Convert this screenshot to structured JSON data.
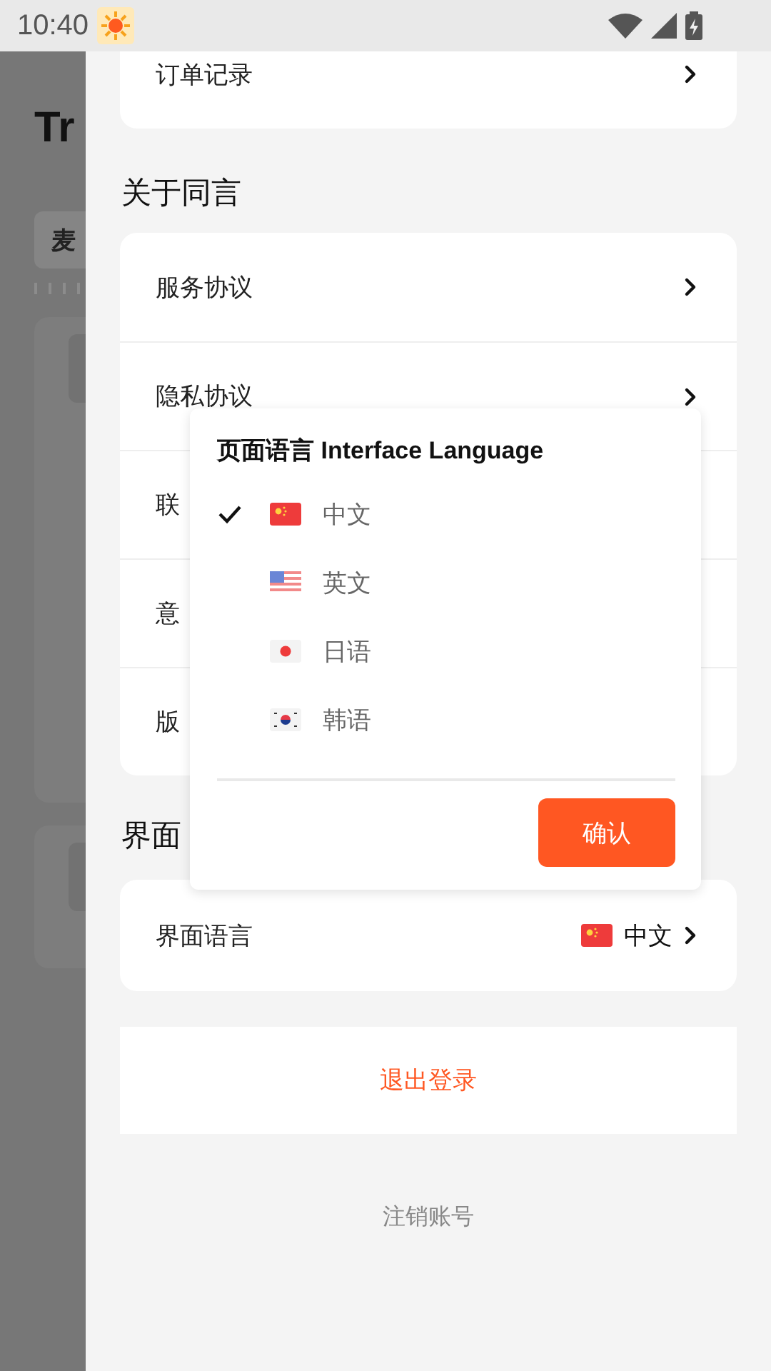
{
  "status_bar": {
    "time": "10:40"
  },
  "background_page": {
    "title": "Tr",
    "tab": "麦"
  },
  "order_row": {
    "label": "订单记录"
  },
  "about_section": {
    "heading": "关于同言",
    "rows": [
      {
        "label": "服务协议",
        "chevron": true
      },
      {
        "label": "隐私协议",
        "chevron": true
      },
      {
        "label": "联",
        "chevron": false
      },
      {
        "label": "意",
        "chevron": false
      },
      {
        "label": "版",
        "chevron": false
      }
    ]
  },
  "interface_section": {
    "heading": "界面",
    "row": {
      "label": "界面语言",
      "value": "中文",
      "kind": "cn"
    }
  },
  "logout_button": "退出登录",
  "delete_account_link": "注销账号",
  "language_dialog": {
    "title": "页面语言 Interface Language",
    "options": [
      {
        "label": "中文",
        "kind": "cn",
        "selected": true
      },
      {
        "label": "英文",
        "kind": "us",
        "selected": false
      },
      {
        "label": "日语",
        "kind": "jp",
        "selected": false
      },
      {
        "label": "韩语",
        "kind": "kr",
        "selected": false
      }
    ],
    "confirm_button": "确认"
  }
}
